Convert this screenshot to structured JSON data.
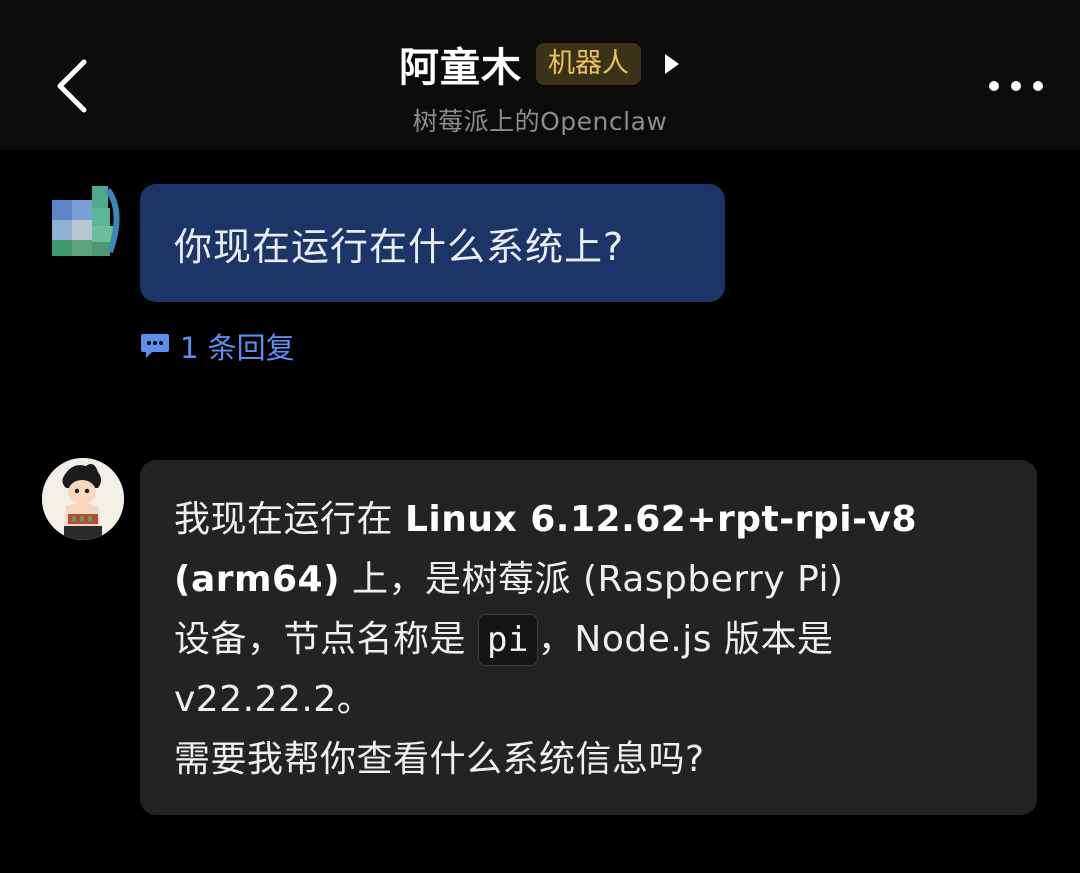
{
  "header": {
    "title": "阿童木",
    "badge": "机器人",
    "subtitle": "树莓派上的Openclaw"
  },
  "messages": {
    "user": {
      "text": "你现在运行在什么系统上?",
      "reply_count_label": "1 条回复"
    },
    "bot": {
      "line1_prefix": "我现在运行在 ",
      "line1_bold": "Linux 6.12.62+rpt-rpi-v8",
      "line2_bold": "(arm64)",
      "line2_rest": " 上，是树莓派 (Raspberry Pi)",
      "line3_prefix": "设备，节点名称是 ",
      "line3_code": "pi",
      "line3_rest": "，Node.js 版本是",
      "line4": "v22.22.2。",
      "line5": "需要我帮你查看什么系统信息吗?"
    }
  },
  "colors": {
    "background": "#000000",
    "user_bubble": "#1c3566",
    "bot_bubble": "#232325",
    "accent": "#5b8ff0",
    "badge_text": "#e8c25b",
    "badge_bg": "#3a3318"
  },
  "icons": {
    "back": "chevron-left-icon",
    "play": "play-icon",
    "more": "more-dots-icon",
    "reply": "chat-bubble-icon"
  }
}
